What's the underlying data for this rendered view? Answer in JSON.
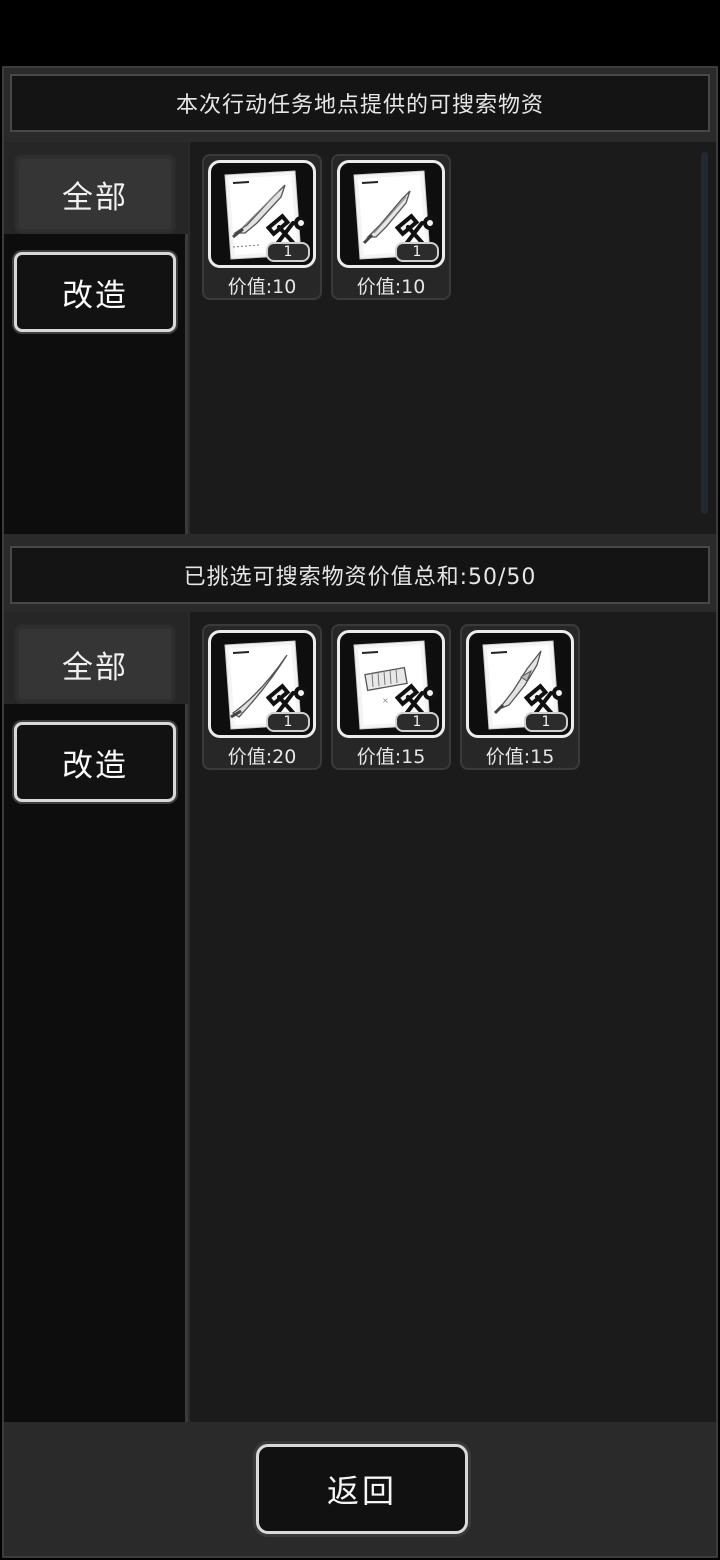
{
  "top_section": {
    "title": "本次行动任务地点提供的可搜索物资",
    "tabs": [
      {
        "label": "全部",
        "active": false
      },
      {
        "label": "改造",
        "active": true
      }
    ],
    "items": [
      {
        "value_label": "价值:10",
        "qty": "1",
        "icon": "blueprint-sword-icon"
      },
      {
        "value_label": "价值:10",
        "qty": "1",
        "icon": "blueprint-dagger-icon"
      }
    ]
  },
  "bottom_section": {
    "title": "已挑选可搜索物资价值总和:50/50",
    "tabs": [
      {
        "label": "全部",
        "active": false
      },
      {
        "label": "改造",
        "active": true
      }
    ],
    "items": [
      {
        "value_label": "价值:20",
        "qty": "1",
        "icon": "blueprint-katana-icon"
      },
      {
        "value_label": "价值:15",
        "qty": "1",
        "icon": "blueprint-module-icon"
      },
      {
        "value_label": "价值:15",
        "qty": "1",
        "icon": "blueprint-blade-icon"
      }
    ]
  },
  "footer": {
    "back_label": "返回"
  },
  "colors": {
    "background": "#000000",
    "panel": "#2a2a2a",
    "content": "#1b1b1b",
    "sidebar": "#0d0d0d",
    "accent_border": "#d8d8d8"
  }
}
